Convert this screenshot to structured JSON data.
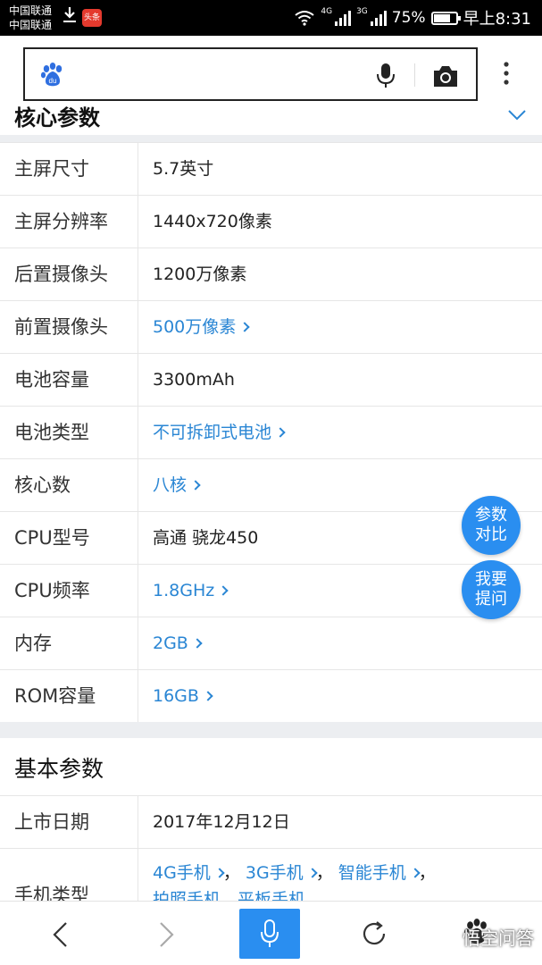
{
  "status_bar": {
    "carrier_1": "中国联通",
    "carrier_2": "中国联通",
    "app_badge": "头条",
    "network_1": "4G",
    "network_2": "3G",
    "battery_percent": "75%",
    "battery_level": 0.75,
    "time": "早上8:31"
  },
  "search_bar": {
    "logo": "du",
    "icons": [
      "baidu-paw-icon",
      "microphone-icon",
      "camera-icon",
      "more-vertical-icon"
    ]
  },
  "core_params": {
    "title": "核心参数",
    "rows": [
      {
        "label": "主屏尺寸",
        "value": "5.7英寸",
        "link": false
      },
      {
        "label": "主屏分辨率",
        "value": "1440x720像素",
        "link": false
      },
      {
        "label": "后置摄像头",
        "value": "1200万像素",
        "link": false
      },
      {
        "label": "前置摄像头",
        "value": "500万像素",
        "link": true
      },
      {
        "label": "电池容量",
        "value": "3300mAh",
        "link": false
      },
      {
        "label": "电池类型",
        "value": "不可拆卸式电池",
        "link": true
      },
      {
        "label": "核心数",
        "value": "八核",
        "link": true
      },
      {
        "label": "CPU型号",
        "value": "高通 骁龙450",
        "link": false
      },
      {
        "label": "CPU频率",
        "value": "1.8GHz",
        "link": true
      },
      {
        "label": "内存",
        "value": "2GB",
        "link": true
      },
      {
        "label": "ROM容量",
        "value": "16GB",
        "link": true
      }
    ]
  },
  "floating_buttons": {
    "compare_line1": "参数",
    "compare_line2": "对比",
    "ask_line1": "我要",
    "ask_line2": "提问"
  },
  "basic_params": {
    "title": "基本参数",
    "release_label": "上市日期",
    "release_value": "2017年12月12日",
    "type_label": "手机类型",
    "type_links": [
      "4G手机",
      "3G手机",
      "智能手机"
    ],
    "type_sep": "，",
    "type_second_line": "拍照手机，平板手机"
  },
  "watermark": "悟空问答",
  "colors": {
    "link": "#2a86d4",
    "accent": "#2a8ef0"
  }
}
